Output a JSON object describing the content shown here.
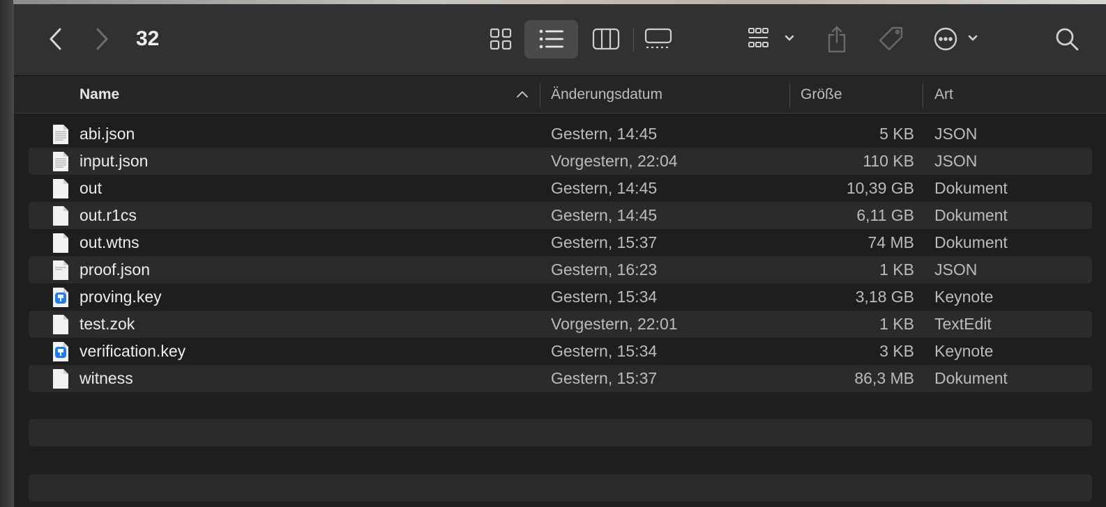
{
  "window": {
    "title": "32"
  },
  "toolbar": {
    "icons": [
      "chevron-left-icon",
      "chevron-right-icon",
      "icon-view-icon",
      "list-view-icon",
      "column-view-icon",
      "gallery-view-icon",
      "group-icon",
      "share-icon",
      "tag-icon",
      "more-icon",
      "search-icon"
    ],
    "active_view": "list"
  },
  "columns": {
    "name": "Name",
    "date": "Änderungsdatum",
    "size": "Größe",
    "kind": "Art"
  },
  "files": [
    {
      "name": "abi.json",
      "date": "Gestern, 14:45",
      "size": "5 KB",
      "kind": "JSON",
      "icon": "text-doc"
    },
    {
      "name": "input.json",
      "date": "Vorgestern, 22:04",
      "size": "110 KB",
      "kind": "JSON",
      "icon": "text-doc"
    },
    {
      "name": "out",
      "date": "Gestern, 14:45",
      "size": "10,39 GB",
      "kind": "Dokument",
      "icon": "blank-doc"
    },
    {
      "name": "out.r1cs",
      "date": "Gestern, 14:45",
      "size": "6,11 GB",
      "kind": "Dokument",
      "icon": "blank-doc"
    },
    {
      "name": "out.wtns",
      "date": "Gestern, 15:37",
      "size": "74 MB",
      "kind": "Dokument",
      "icon": "blank-doc"
    },
    {
      "name": "proof.json",
      "date": "Gestern, 16:23",
      "size": "1 KB",
      "kind": "JSON",
      "icon": "text-doc"
    },
    {
      "name": "proving.key",
      "date": "Gestern, 15:34",
      "size": "3,18 GB",
      "kind": "Keynote",
      "icon": "keynote"
    },
    {
      "name": "test.zok",
      "date": "Vorgestern, 22:01",
      "size": "1 KB",
      "kind": "TextEdit",
      "icon": "blank-doc"
    },
    {
      "name": "verification.key",
      "date": "Gestern, 15:34",
      "size": "3 KB",
      "kind": "Keynote",
      "icon": "keynote"
    },
    {
      "name": "witness",
      "date": "Gestern, 15:37",
      "size": "86,3 MB",
      "kind": "Dokument",
      "icon": "blank-doc"
    }
  ]
}
